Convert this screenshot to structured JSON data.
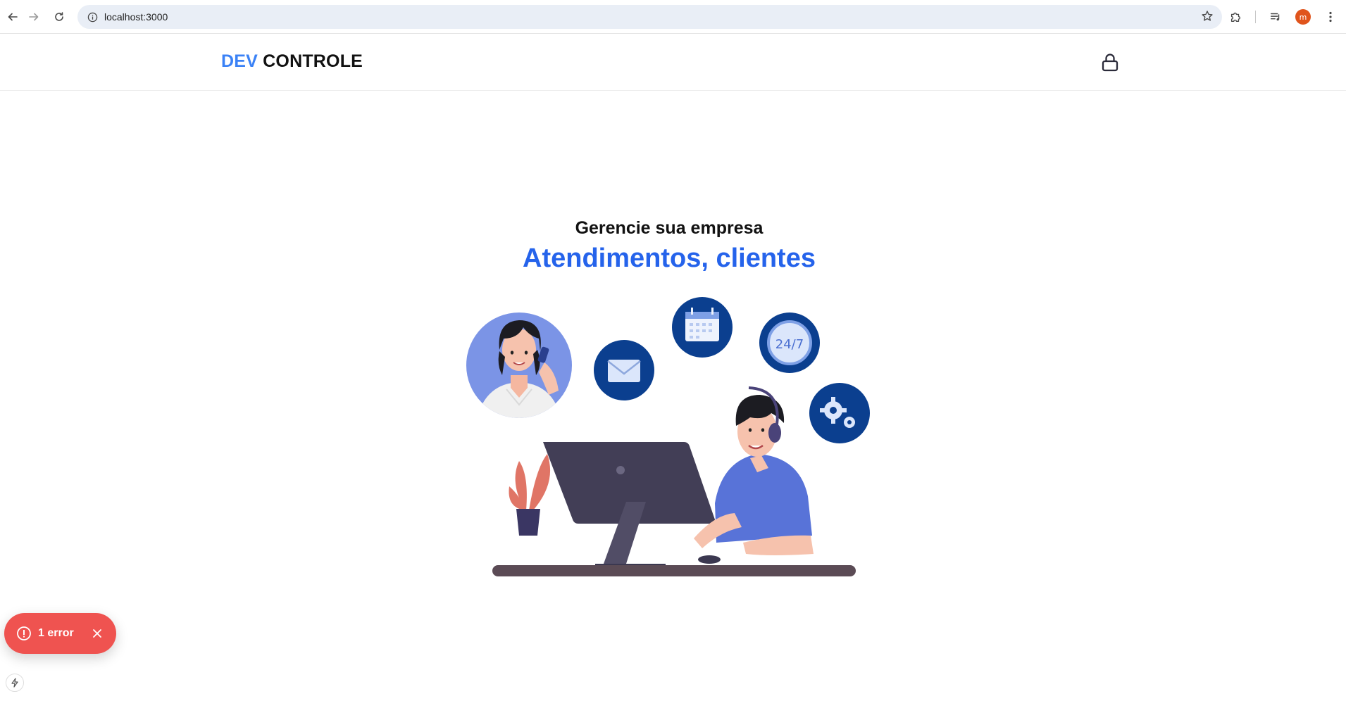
{
  "browser": {
    "url": "localhost:3000",
    "profile_initial": "m",
    "icons": {
      "back": "arrow-left-icon",
      "forward": "arrow-right-icon",
      "reload": "reload-icon",
      "site_info": "info-icon",
      "bookmark": "star-icon",
      "extensions": "puzzle-icon",
      "media": "media-control-icon",
      "menu": "kebab-menu-icon"
    }
  },
  "header": {
    "logo_part1": "DEV",
    "logo_part2": "CONTROLE",
    "login_icon": "lock-icon",
    "colors": {
      "logo_accent": "#3b82f6",
      "logo_text": "#111111"
    }
  },
  "hero": {
    "subtitle": "Gerencie sua empresa",
    "headline": "Atendimentos, clientes",
    "headline_color": "#2563eb",
    "illustration": {
      "badge_clock_text": "24/7"
    }
  },
  "dev_overlay": {
    "error_label": "1 error",
    "error_color": "#ef5350"
  }
}
